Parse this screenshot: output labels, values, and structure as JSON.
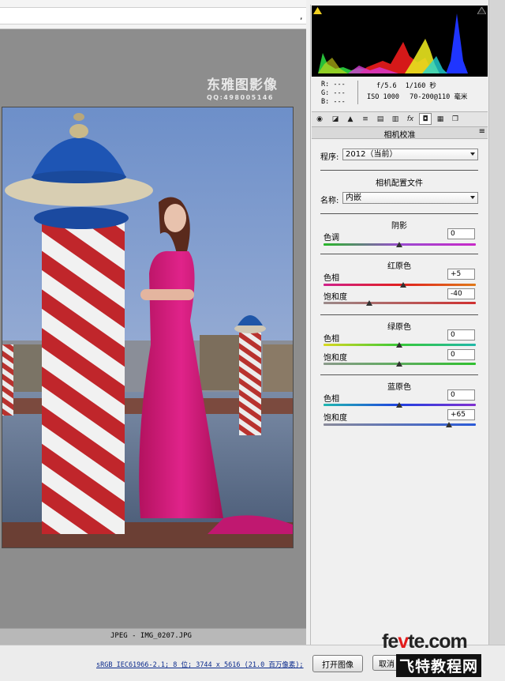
{
  "toolbar": {
    "trailing_text": ","
  },
  "watermark": {
    "line1": "东雅图影像",
    "line2": "QQ:498005146"
  },
  "statusbar": {
    "text": "JPEG -  IMG_0207.JPG"
  },
  "bottom": {
    "info_link": "sRGB IEC61966-2.1; 8 位; 3744 x 5616 (21.0 百万像素);",
    "open_button": "打开图像",
    "cancel_button": "取消"
  },
  "logo": {
    "line1_a": "fe",
    "line1_b": "v",
    "line1_c": "te.com",
    "line2": "飞特教程网"
  },
  "histogram": {
    "channels": [
      "red",
      "green",
      "blue",
      "yellow",
      "cyan",
      "magenta"
    ]
  },
  "readout": {
    "r": "R:  ---",
    "g": "G:  ---",
    "b": "B:  ---",
    "aperture": "f/5.6",
    "shutter": "1/160 秒",
    "iso": "ISO 1000",
    "lens": "70-200@110 毫米"
  },
  "tabs": [
    "basic-icon",
    "tone-curve-icon",
    "detail-icon",
    "hsl-icon",
    "split-toning-icon",
    "lens-icon",
    "fx-icon",
    "camera-calibration-icon",
    "presets-icon",
    "snapshots-icon"
  ],
  "panel": {
    "title": "相机校准",
    "process_label": "程序:",
    "process_value": "2012（当前）",
    "profile_heading": "相机配置文件",
    "name_label": "名称:",
    "name_value": "内嵌",
    "shadows": {
      "heading": "阴影",
      "tint_label": "色调",
      "tint_value": "0",
      "tint_level": 0
    },
    "red": {
      "heading": "红原色",
      "hue_label": "色相",
      "hue_value": "+5",
      "hue_level": 5,
      "sat_label": "饱和度",
      "sat_value": "-40",
      "sat_level": -40
    },
    "green": {
      "heading": "绿原色",
      "hue_label": "色相",
      "hue_value": "0",
      "hue_level": 0,
      "sat_label": "饱和度",
      "sat_value": "0",
      "sat_level": 0
    },
    "blue": {
      "heading": "蓝原色",
      "hue_label": "色相",
      "hue_value": "0",
      "hue_level": 0,
      "sat_label": "饱和度",
      "sat_value": "+65",
      "sat_level": 65
    }
  },
  "colors": {
    "accent_button_border": "#7a7a7a",
    "link": "#0a2a8c",
    "dress": "#d01a74"
  }
}
